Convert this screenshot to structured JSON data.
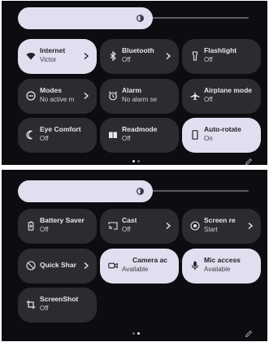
{
  "panel_1": {
    "tiles": [
      {
        "title": "Internet",
        "subtitle": "Victor",
        "state": "on",
        "icon": "wifi-icon",
        "chevron": true
      },
      {
        "title": "Bluetooth",
        "subtitle": "Off",
        "state": "off",
        "icon": "bluetooth-icon",
        "chevron": true
      },
      {
        "title": "Flashlight",
        "subtitle": "Off",
        "state": "off",
        "icon": "flashlight-icon",
        "chevron": false
      },
      {
        "title": "Modes",
        "subtitle": "No active m",
        "state": "off",
        "icon": "modes-icon",
        "chevron": true
      },
      {
        "title": "Alarm",
        "subtitle": "No alarm se",
        "state": "off",
        "icon": "alarm-icon",
        "chevron": false
      },
      {
        "title": "Airplane mode",
        "subtitle": "Off",
        "state": "off",
        "icon": "airplane-icon",
        "chevron": false
      },
      {
        "title": "Eye Comfort",
        "subtitle": "Off",
        "state": "off",
        "icon": "eye-comfort-icon",
        "chevron": false
      },
      {
        "title": "Readmode",
        "subtitle": "Off",
        "state": "off",
        "icon": "readmode-icon",
        "chevron": false
      },
      {
        "title": "Auto-rotate",
        "subtitle": "On",
        "state": "on",
        "icon": "auto-rotate-icon",
        "chevron": false
      }
    ],
    "page_indicator": {
      "current": 1,
      "total": 2
    }
  },
  "panel_2": {
    "tiles": [
      {
        "title": "Battery Saver",
        "subtitle": "Off",
        "state": "off",
        "icon": "battery-saver-icon",
        "chevron": false
      },
      {
        "title": "Cast",
        "subtitle": "Off",
        "state": "off",
        "icon": "cast-icon",
        "chevron": true
      },
      {
        "title": "Screen re",
        "subtitle": "Start",
        "state": "off",
        "icon": "screen-record-icon",
        "chevron": true
      },
      {
        "title": "Quick Shar",
        "subtitle": "",
        "state": "off",
        "icon": "quick-share-icon",
        "chevron": true
      },
      {
        "title": "Camera ac",
        "subtitle": "Available",
        "state": "on",
        "icon": "camera-access-icon",
        "chevron": false
      },
      {
        "title": "Mic access",
        "subtitle": "Available",
        "state": "on",
        "icon": "mic-access-icon",
        "chevron": false
      },
      {
        "title": "ScreenShot",
        "subtitle": "Off",
        "state": "off",
        "icon": "screenshot-icon",
        "chevron": false
      }
    ],
    "page_indicator": {
      "current": 2,
      "total": 2
    }
  },
  "colors": {
    "panel_bg": "#0c0d10",
    "tile_off": "#2b2c30",
    "tile_on": "#e2deef",
    "text_light": "#e8e6ee",
    "text_dark": "#23212b"
  }
}
